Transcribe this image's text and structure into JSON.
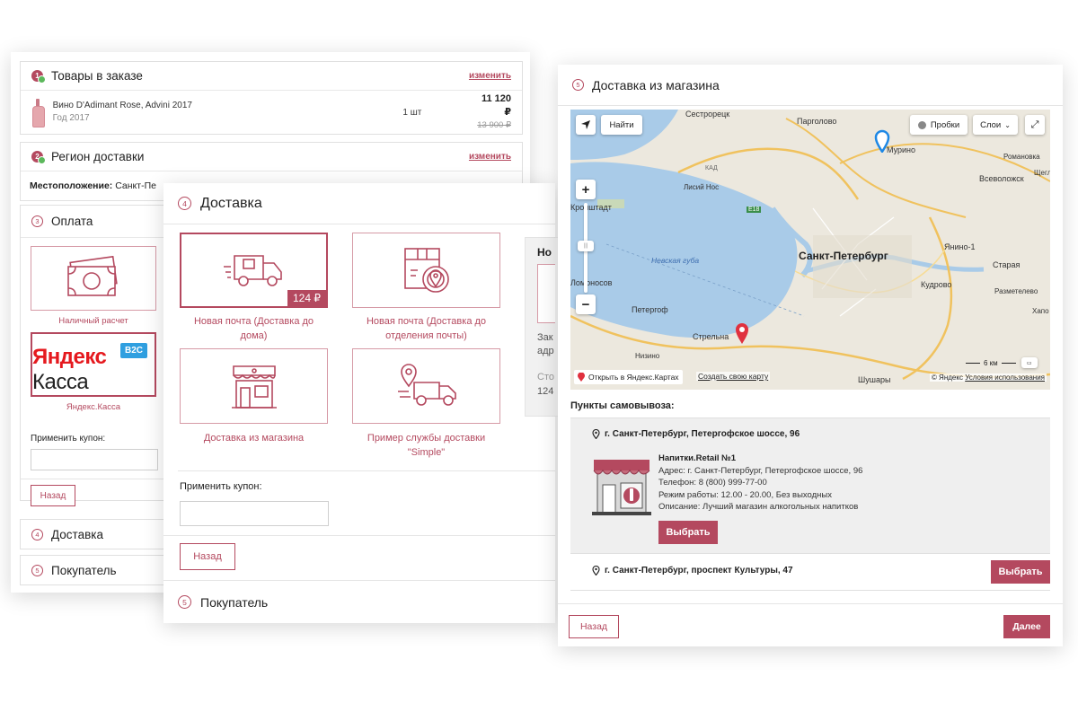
{
  "card_order": {
    "items_section": {
      "step": "1",
      "title": "Товары в заказе",
      "edit_label": "изменить"
    },
    "product": {
      "name": "Вино D'Adimant Rose, Advini 2017",
      "year": "Год 2017",
      "qty": "1 шт",
      "price": "11 120 ₽",
      "old_price": "13 900 ₽"
    },
    "region_section": {
      "step": "2",
      "title": "Регион доставки",
      "edit_label": "изменить"
    },
    "location": {
      "label": "Местоположение:",
      "value": "Санкт-Пе"
    },
    "payment_section": {
      "step": "3",
      "title": "Оплата"
    },
    "payment_cash_label": "Наличный расчет",
    "payment_yandex_label": "Яндекс.Касса",
    "yandex_logo": {
      "part1": "Яндекс",
      "part2": " Касса",
      "badge": "B2C"
    },
    "coupon_label": "Применить купон:",
    "back_label": "Назад",
    "delivery_section": {
      "step": "4",
      "title": "Доставка"
    },
    "buyer_section": {
      "step": "5",
      "title": "Покупатель"
    }
  },
  "card_delivery": {
    "step": "4",
    "title": "Доставка",
    "options": [
      {
        "label": "Новая почта (Доставка до дома)",
        "price": "124 ₽",
        "icon": "delivery-van-icon"
      },
      {
        "label": "Новая почта (Доставка до отделения почты)",
        "icon": "parcel-location-icon"
      },
      {
        "label": "Доставка из магазина",
        "icon": "store-icon"
      },
      {
        "label": "Пример службы доставки \"Simple\"",
        "icon": "truck-location-icon"
      }
    ],
    "aside": {
      "title_fragment": "Но",
      "line1": "Зак",
      "line2": "адр",
      "line3": "Сто",
      "line4": "124"
    },
    "coupon_label": "Применить купон:",
    "back_label": "Назад",
    "buyer_section": {
      "step": "5",
      "title": "Покупатель"
    }
  },
  "card_store": {
    "step": "5",
    "title": "Доставка из магазина",
    "map": {
      "find_label": "Найти",
      "traffic_label": "Пробки",
      "layers_label": "Слои",
      "open_label": "Открыть в Яндекс.Картах",
      "create_label": "Создать свою карту",
      "copyright": "© Яндекс",
      "terms_label": "Условия использования",
      "scale_label": "6 км",
      "places": [
        "Сестрорецк",
        "Парголово",
        "Мурино",
        "Романовка",
        "Щеглово",
        "Всеволожск",
        "Лисий Нос",
        "Кронштадт",
        "Санкт-Петербург",
        "Янино-1",
        "Старая",
        "Невская губа",
        "Ломоносов",
        "Кудрово",
        "Разметелево",
        "Петергоф",
        "Стрельна",
        "Хапо",
        "Низино",
        "Шушары",
        "Е18",
        "КАД"
      ]
    },
    "pickup_title": "Пункты самовывоза:",
    "points": [
      {
        "address": "г. Санкт-Петербург, Петергофское шоссе, 96"
      },
      {
        "address": "г. Санкт-Петербург, проспект Культуры, 47"
      }
    ],
    "store": {
      "name": "Напитки.Retail №1",
      "address": "Адрес: г. Санкт-Петербург, Петергофское шоссе, 96",
      "phone": "Телефон: 8 (800) 999-77-00",
      "hours": "Режим работы: 12.00 - 20.00, Без выходных",
      "description": "Описание: Лучший магазин алкогольных напитков"
    },
    "select_label": "Выбрать",
    "back_label": "Назад",
    "next_label": "Далее"
  },
  "colors": {
    "accent": "#b4495f",
    "success": "#5cb85c",
    "water": "#a9cbe8",
    "land": "#e9e5da"
  }
}
